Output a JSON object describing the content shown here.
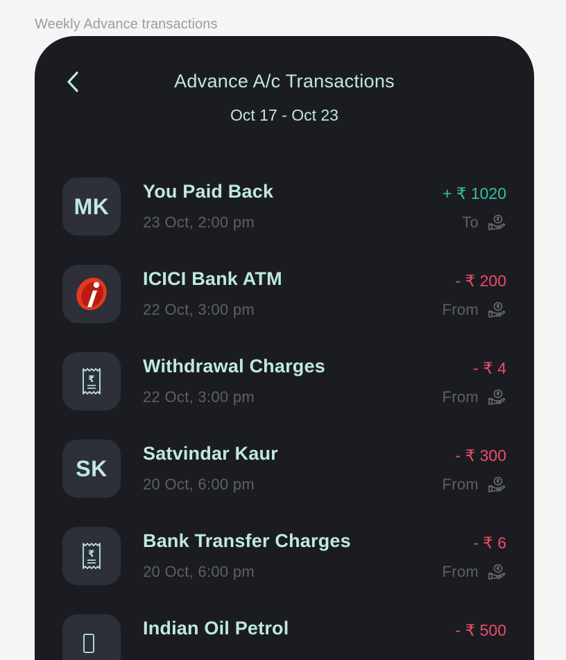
{
  "frame": {
    "caption": "Weekly Advance transactions"
  },
  "header": {
    "title": "Advance A/c Transactions",
    "date_range": "Oct 17 - Oct 23"
  },
  "colors": {
    "background": "#1b1c21",
    "accent_text": "#bfe8e2",
    "credit": "#35c2a5",
    "debit": "#ef4b6a",
    "muted": "#5d6069"
  },
  "transactions": [
    {
      "avatar_text": "MK",
      "avatar_icon": "",
      "name": "You Paid Back",
      "datetime": "23 Oct, 2:00 pm",
      "amount": "+ ₹ 1020",
      "type": "credit",
      "direction": "To",
      "direction_icon": "hand-rupee-icon"
    },
    {
      "avatar_text": "",
      "avatar_icon": "icici-bank-logo",
      "name": "ICICI Bank ATM",
      "datetime": "22 Oct, 3:00 pm",
      "amount": "- ₹ 200",
      "type": "debit",
      "direction": "From",
      "direction_icon": "hand-rupee-icon"
    },
    {
      "avatar_text": "",
      "avatar_icon": "receipt-icon",
      "name": "Withdrawal Charges",
      "datetime": "22 Oct, 3:00 pm",
      "amount": "- ₹ 4",
      "type": "debit",
      "direction": "From",
      "direction_icon": "hand-rupee-icon"
    },
    {
      "avatar_text": "SK",
      "avatar_icon": "",
      "name": "Satvindar Kaur",
      "datetime": "20 Oct, 6:00 pm",
      "amount": "- ₹ 300",
      "type": "debit",
      "direction": "From",
      "direction_icon": "hand-rupee-icon"
    },
    {
      "avatar_text": "",
      "avatar_icon": "receipt-icon",
      "name": "Bank Transfer Charges",
      "datetime": "20 Oct, 6:00 pm",
      "amount": "- ₹ 6",
      "type": "debit",
      "direction": "From",
      "direction_icon": "hand-rupee-icon"
    },
    {
      "avatar_text": "",
      "avatar_icon": "fuel-icon",
      "name": "Indian Oil Petrol",
      "datetime": "",
      "amount": "- ₹ 500",
      "type": "debit",
      "direction": "",
      "direction_icon": "hand-rupee-icon"
    }
  ]
}
